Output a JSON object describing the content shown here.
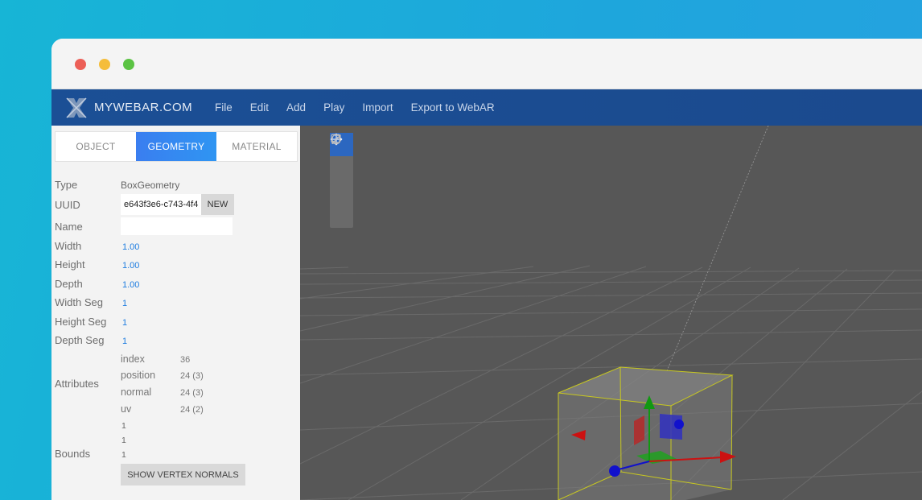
{
  "app": {
    "brand": "MYWEBAR.COM",
    "menu": [
      "File",
      "Edit",
      "Add",
      "Play",
      "Import",
      "Export to WebAR"
    ]
  },
  "panel": {
    "tabs": [
      {
        "label": "OBJECT",
        "active": false
      },
      {
        "label": "GEOMETRY",
        "active": true
      },
      {
        "label": "MATERIAL",
        "active": false
      }
    ],
    "type_label": "Type",
    "type_value": "BoxGeometry",
    "uuid_label": "UUID",
    "uuid_value": "e643f3e6-c743-4f4",
    "new_label": "NEW",
    "name_label": "Name",
    "name_value": "",
    "width_label": "Width",
    "width_value": "1.00",
    "height_label": "Height",
    "height_value": "1.00",
    "depth_label": "Depth",
    "depth_value": "1.00",
    "width_seg_label": "Width Seg",
    "width_seg_value": "1",
    "height_seg_label": "Height Seg",
    "height_seg_value": "1",
    "depth_seg_label": "Depth Seg",
    "depth_seg_value": "1",
    "attributes_label": "Attributes",
    "attributes": [
      {
        "name": "index",
        "value": "36"
      },
      {
        "name": "position",
        "value": "24 (3)"
      },
      {
        "name": "normal",
        "value": "24 (3)"
      },
      {
        "name": "uv",
        "value": "24 (2)"
      }
    ],
    "bounds_label": "Bounds",
    "bounds": [
      "1",
      "1",
      "1"
    ],
    "show_vertex_normals_label": "SHOW VERTEX NORMALS"
  },
  "viewport": {
    "tools": [
      "move-icon",
      "rotate-icon",
      "scale-icon",
      "square-icon"
    ],
    "active_tool": "move-icon",
    "colors": {
      "x_axis": "#cc1111",
      "y_axis": "#119911",
      "z_axis": "#1111cc",
      "selection": "#c8c820"
    }
  }
}
